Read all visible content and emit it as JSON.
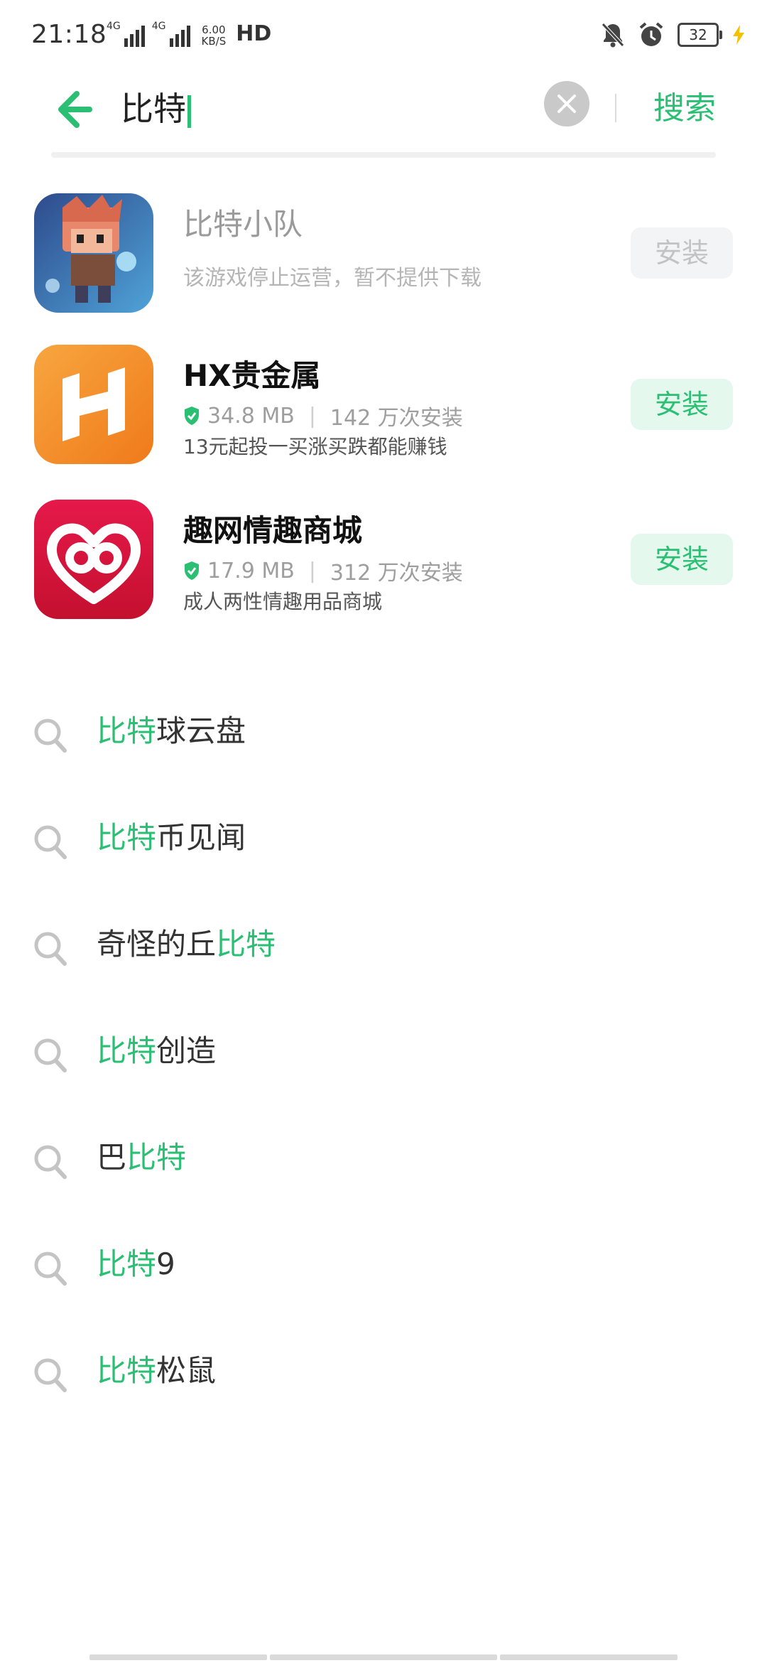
{
  "status_bar": {
    "time": "21:18",
    "network_1": "4G",
    "network_2": "4G",
    "speed_value": "6.00",
    "speed_unit": "KB/S",
    "hd_label": "HD",
    "battery_level": "32"
  },
  "search": {
    "query": "比特",
    "search_button": "搜索",
    "accent_color": "#2bbf74"
  },
  "apps": [
    {
      "name": "比特小队",
      "notice": "该游戏停止运营，暂不提供下载",
      "install_label": "安装",
      "available": false
    },
    {
      "name": "HX贵金属",
      "size": "34.8 MB",
      "installs": "142 万次安装",
      "description": "13元起投一买涨买跌都能赚钱",
      "install_label": "安装",
      "available": true
    },
    {
      "name": "趣网情趣商城",
      "size": "17.9 MB",
      "installs": "312 万次安装",
      "description": "成人两性情趣用品商城",
      "install_label": "安装",
      "available": true
    }
  ],
  "suggestions": [
    {
      "before": "",
      "match": "比特",
      "after": "球云盘"
    },
    {
      "before": "",
      "match": "比特",
      "after": "币见闻"
    },
    {
      "before": "奇怪的丘",
      "match": "比特",
      "after": ""
    },
    {
      "before": "",
      "match": "比特",
      "after": "创造"
    },
    {
      "before": "巴",
      "match": "比特",
      "after": ""
    },
    {
      "before": "",
      "match": "比特",
      "after": "9"
    },
    {
      "before": "",
      "match": "比特",
      "after": "松鼠"
    }
  ]
}
